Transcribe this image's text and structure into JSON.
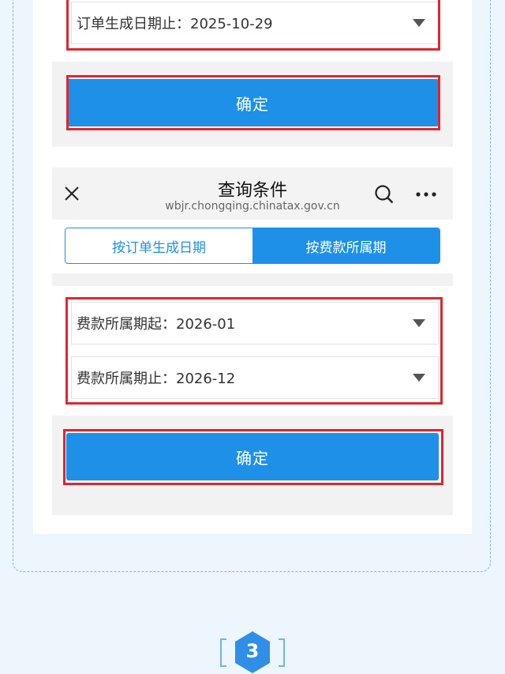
{
  "top_section": {
    "end_date_field": {
      "label": "订单生成日期止：",
      "value": "2025-10-29"
    },
    "confirm_label": "确定"
  },
  "nav": {
    "title": "查询条件",
    "url": "wbjr.chongqing.chinatax.gov.cn",
    "close_icon": "close-icon",
    "search_icon": "search-icon",
    "more_icon": "more-icon"
  },
  "tabs": [
    {
      "label": "按订单生成日期",
      "active": false
    },
    {
      "label": "按费款所属期",
      "active": true
    }
  ],
  "bottom_section": {
    "start_field": {
      "label": "费款所属期起：",
      "value": "2026-01"
    },
    "end_field": {
      "label": "费款所属期止：",
      "value": "2026-12"
    },
    "confirm_label": "确定"
  },
  "step": {
    "number": "3"
  },
  "colors": {
    "accent": "#1e90e8",
    "highlight": "#e0262e",
    "page_bg": "#edf6fd"
  }
}
